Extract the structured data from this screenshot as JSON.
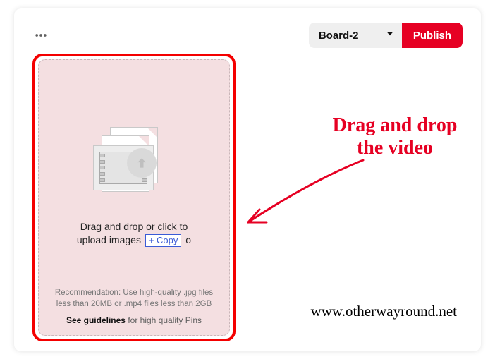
{
  "topbar": {
    "board_selected": "Board-2",
    "publish_label": "Publish"
  },
  "dropzone": {
    "cta_line1": "Drag and drop or click to",
    "cta_line2a": "upload images",
    "copy_chip": "+ Copy",
    "cta_line2b": "o",
    "recommendation": "Recommendation: Use high-quality .jpg files less than 20MB or .mp4 files less than 2GB",
    "guidelines_bold": "See guidelines",
    "guidelines_rest": " for high quality Pins"
  },
  "annotation": {
    "line1": "Drag and drop",
    "line2": "the video"
  },
  "watermark": "www.otherwayround.net"
}
